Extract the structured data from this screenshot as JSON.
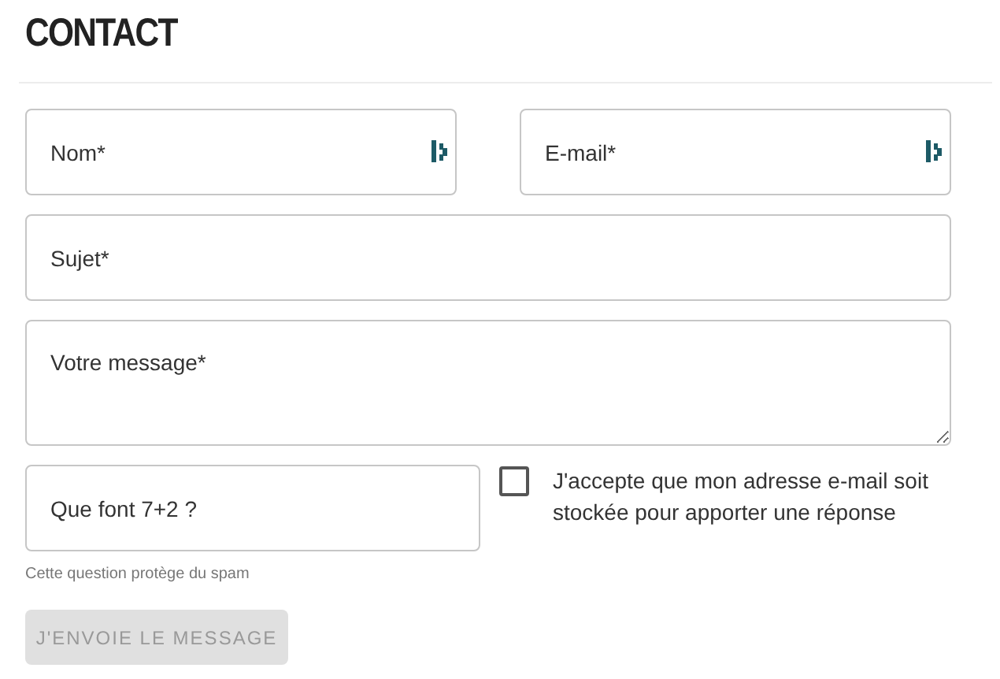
{
  "title": "CONTACT",
  "rows": [
    {
      "fields": [
        {
          "kind": "input",
          "placeholder": "Nom*",
          "autofill_icon": true
        },
        {
          "kind": "input",
          "placeholder": "E-mail*",
          "autofill_icon": true
        }
      ]
    },
    {
      "fields": [
        {
          "kind": "input",
          "placeholder": "Sujet*",
          "autofill_icon": false
        }
      ]
    },
    {
      "fields": [
        {
          "kind": "textarea",
          "placeholder": "Votre message*",
          "autofill_icon": false
        }
      ]
    }
  ],
  "captcha": {
    "placeholder": "Que font 7+2 ?",
    "hint": "Cette question protège du spam"
  },
  "consent": {
    "checked": false,
    "label": "J'accepte que mon adresse e-mail soit stockée pour apporter une réponse"
  },
  "submit": {
    "label": "J'ENVOIE LE MESSAGE",
    "disabled": true
  }
}
